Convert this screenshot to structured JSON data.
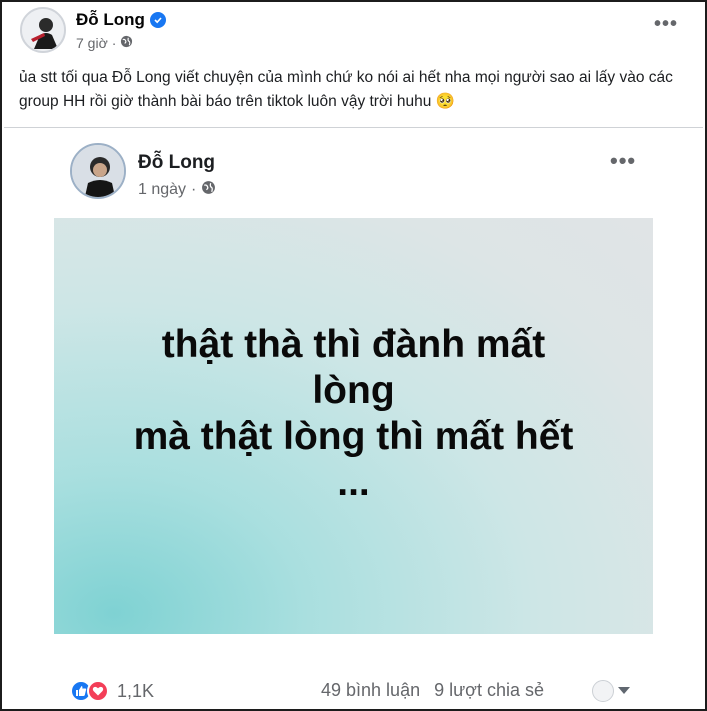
{
  "post": {
    "author": "Đỗ Long",
    "time": "7 giờ",
    "separator": "·",
    "text": "ủa stt  tối qua Đỗ Long viết chuyện của mình chứ ko nói ai hết nha mọi người sao ai lấy vào các group HH rồi giờ thành bài báo trên tiktok luôn vậy trời huhu 🥺"
  },
  "shared_post": {
    "author": "Đỗ Long",
    "time": "1 ngày",
    "separator": "·",
    "quote_lines": [
      "thật thà thì đành mất",
      "lòng",
      "mà thật lòng thì mất hết",
      "..."
    ]
  },
  "footer": {
    "reaction_count": "1,1K",
    "comments": "49 bình luận",
    "shares": "9 lượt chia sẻ"
  },
  "colors": {
    "verified": "#1877f2",
    "like": "#1877f2",
    "love": "#f33e58",
    "quote_bg": "#a9dfdf"
  }
}
